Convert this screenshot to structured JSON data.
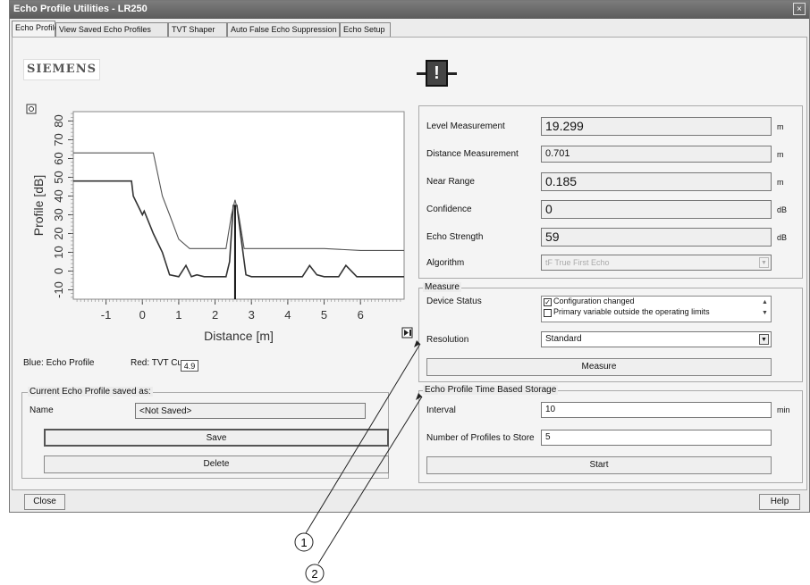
{
  "window": {
    "title": "Echo Profile Utilities - LR250",
    "close_glyph": "×"
  },
  "tabs": [
    {
      "label": "Echo Profile"
    },
    {
      "label": "View Saved Echo Profiles"
    },
    {
      "label": "TVT Shaper"
    },
    {
      "label": "Auto False Echo Suppression"
    },
    {
      "label": "Echo Setup"
    }
  ],
  "brand": {
    "logo_text": "SIEMENS"
  },
  "status_icon": {
    "glyph": "!",
    "name": "warning-icon"
  },
  "chart": {
    "x_tick_labels": [
      "-1",
      "0",
      "1",
      "2",
      "3",
      "4",
      "5",
      "6"
    ],
    "y_tick_labels": [
      "-10",
      "0",
      "10",
      "20",
      "30",
      "40",
      "50",
      "60",
      "70",
      "80"
    ],
    "xlabel": "Distance [m]",
    "ylabel": "Profile [dB]",
    "cursor_label": "4.9"
  },
  "chart_data": {
    "type": "line",
    "xlabel": "Distance [m]",
    "ylabel": "Profile [dB]",
    "xlim": [
      -1.9,
      7.2
    ],
    "ylim": [
      -15,
      85
    ],
    "series": [
      {
        "name": "Blue: Echo Profile",
        "x": [
          -1.9,
          -0.5,
          -0.3,
          -0.25,
          0,
          0.05,
          0.3,
          0.55,
          0.75,
          1.0,
          1.2,
          1.35,
          1.5,
          1.7,
          2.0,
          2.3,
          2.4,
          2.5,
          2.6,
          2.7,
          2.85,
          3.0,
          3.5,
          4.0,
          4.4,
          4.6,
          4.8,
          5.0,
          5.4,
          5.6,
          5.9,
          6.2,
          6.6,
          7.2
        ],
        "y": [
          48,
          48,
          48,
          40,
          30,
          32,
          20,
          10,
          -2,
          -3,
          3,
          -3,
          -2,
          -3,
          -3,
          -3,
          5,
          35,
          35,
          20,
          -2,
          -3,
          -3,
          -3,
          -3,
          3,
          -2,
          -3,
          -3,
          3,
          -3,
          -3,
          -3,
          -3
        ]
      },
      {
        "name": "Red: TVT Curve",
        "x": [
          -1.9,
          -0.5,
          0,
          0.3,
          0.55,
          0.75,
          1.0,
          1.3,
          1.6,
          2.0,
          2.3,
          2.45,
          2.55,
          2.65,
          2.8,
          3.0,
          4.0,
          5.0,
          6.0,
          7.2
        ],
        "y": [
          63,
          63,
          63,
          63,
          40,
          30,
          17,
          12,
          12,
          12,
          12,
          30,
          38,
          30,
          12,
          12,
          12,
          12,
          11,
          11
        ]
      }
    ],
    "cursor_x": 2.55
  },
  "legend": {
    "blue": "Blue: Echo Profile",
    "red": "Red: TVT Curve"
  },
  "measurements": [
    {
      "label": "Level Measurement",
      "value": "19.299",
      "unit": "m",
      "big": true
    },
    {
      "label": "Distance Measurement",
      "value": "0.701",
      "unit": "m",
      "big": false
    },
    {
      "label": "Near Range",
      "value": "0.185",
      "unit": "m",
      "big": true
    },
    {
      "label": "Confidence",
      "value": "0",
      "unit": "dB",
      "big": true
    },
    {
      "label": "Echo Strength",
      "value": "59",
      "unit": "dB",
      "big": true
    }
  ],
  "algorithm": {
    "label": "Algorithm",
    "value": "tF  True First Echo"
  },
  "measure_group": {
    "title": "Measure",
    "device_status_label": "Device Status",
    "status_items": [
      {
        "text": "Configuration changed",
        "checked": true
      },
      {
        "text": "Primary variable outside the operating limits",
        "checked": false
      }
    ],
    "resolution_label": "Resolution",
    "resolution_value": "Standard",
    "measure_button": "Measure"
  },
  "storage_group": {
    "title": "Echo Profile Time Based Storage",
    "interval_label": "Interval",
    "interval_value": "10",
    "interval_unit": "min",
    "profiles_label": "Number of Profiles to Store",
    "profiles_value": "5",
    "start_button": "Start"
  },
  "saved_group": {
    "title": "Current Echo Profile saved as:",
    "name_label": "Name",
    "name_value": "<Not Saved>",
    "save_button": "Save",
    "delete_button": "Delete"
  },
  "footer": {
    "close_button": "Close",
    "help_button": "Help"
  },
  "callouts": [
    {
      "label": "1"
    },
    {
      "label": "2"
    }
  ]
}
